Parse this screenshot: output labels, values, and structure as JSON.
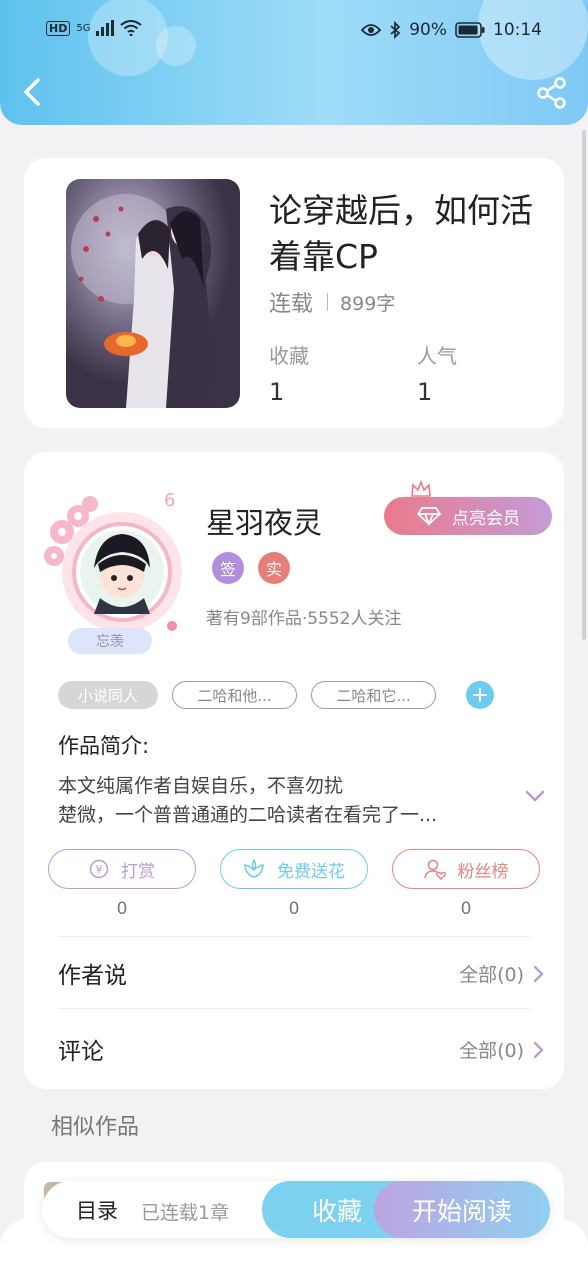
{
  "status_bar": {
    "network": "HD",
    "signal": "5G",
    "battery": "90%",
    "time": "10:14"
  },
  "book": {
    "title": "论穿越后，如何活着靠CP",
    "status": "连载",
    "word_count": "899字",
    "favorites_label": "收藏",
    "favorites_value": "1",
    "popularity_label": "人气",
    "popularity_value": "1"
  },
  "author": {
    "name": "星羽夜灵",
    "level": "6",
    "avatar_caption": "忘羡",
    "vip_label": "点亮会员",
    "badges": [
      "签",
      "实"
    ],
    "stats": "著有9部作品·5552人关注"
  },
  "tags": [
    "小说同人",
    "二哈和他...",
    "二哈和它..."
  ],
  "intro": {
    "title": "作品简介:",
    "line1": "本文纯属作者自娱自乐，不喜勿扰",
    "line2": "楚微，一个普普通通的二哈读者在看完了一..."
  },
  "actions": [
    {
      "label": "打赏",
      "count": "0"
    },
    {
      "label": "免费送花",
      "count": "0"
    },
    {
      "label": "粉丝榜",
      "count": "0"
    }
  ],
  "author_says": {
    "label": "作者说",
    "link": "全部(0)"
  },
  "comments": {
    "label": "评论",
    "link": "全部(0)"
  },
  "similar_title": "相似作品",
  "bottom_bar": {
    "toc": "目录",
    "chapters": "已连载1章",
    "collect": "收藏",
    "read": "开始阅读"
  },
  "colors": {
    "header": "#5ec2ee",
    "reward": "#b79ad8",
    "flower": "#6fcaf0",
    "fans": "#e4857f",
    "badge_sign": "#b18fdc",
    "badge_real": "#e48078"
  }
}
